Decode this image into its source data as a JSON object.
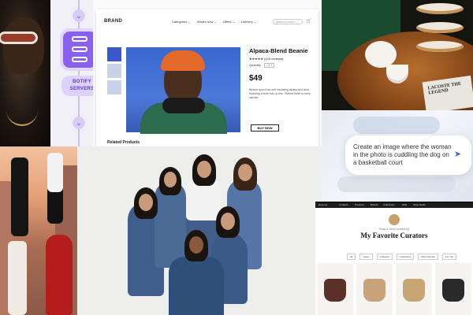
{
  "botify": {
    "label": "BOTIFY SERVERS",
    "connector_glyph": "⌄"
  },
  "shop": {
    "brand": "BRAND",
    "nav": [
      "Categories ⌄",
      "What's new ⌄",
      "Offers ⌄",
      "Delivery ⌄"
    ],
    "search_placeholder": "Search product",
    "cart_icon": "cart-icon",
    "product_title": "Alpaca-Blend Beanie",
    "rating": "★★★★★ (120 reviews)",
    "quantity_label": "Quantity",
    "quantity_value": "- 1 +",
    "price": "$49",
    "description": "Beanie spun from soft insulating alpaca and wool featuring a wide fold-up trim. Ribbed finish to keep warmth.",
    "buy_label": "BUY NOW",
    "related_heading": "Related Products"
  },
  "tea": {
    "newspaper_headline": "LACOSTE THE LEGEND"
  },
  "prompt": {
    "text": "Create an image where the woman in the photo is cuddling the dog on a basketball court",
    "send_icon": "send-icon"
  },
  "curators": {
    "nav": [
      "shop.my",
      "Curators",
      "Products",
      "Brands",
      "Collections",
      "Gifts",
      "Shop Guide"
    ],
    "subtitle": "Shop & Save curated by",
    "title": "My Favorite Curators",
    "filters": [
      "All",
      "Latest",
      "Followed",
      "Collections",
      "Most Popular",
      "For You"
    ],
    "bag_colors": [
      "#5a3028",
      "#c9a27a",
      "#c8a574",
      "#2a2a2a"
    ]
  }
}
